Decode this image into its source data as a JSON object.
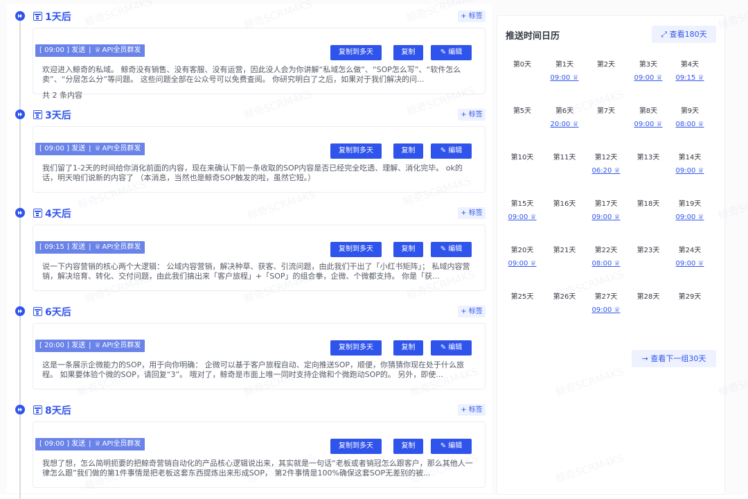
{
  "watermark": "鲸奇SCRM4KS",
  "days": [
    {
      "title": "1天后",
      "tag_button": "+ 标签",
      "send_label": "[ 09:00 ] 发送",
      "mode": "API全员群发",
      "buttons": {
        "multi": "复制到多天",
        "copy": "复制",
        "edit": "编辑"
      },
      "content": "欢迎进入鲸奇的私域。 鲸奇没有销售、没有客服、没有运营，因此没人会为你讲解“私域怎么做”、“SOP怎么写”、“软件怎么卖”、“分层怎么分”等问题。 这些问题全部在公众号可以免费查阅。 你研究明白了之后，如果对于我们解决的问...",
      "count": "共 2 条内容"
    },
    {
      "title": "3天后",
      "tag_button": "+ 标签",
      "send_label": "[ 09:00 ] 发送",
      "mode": "API全员群发",
      "buttons": {
        "multi": "复制到多天",
        "copy": "复制",
        "edit": "编辑"
      },
      "content": "我们留了1-2天的时间给你消化前面的内容，现在来确认下前一条收取的SOP内容是否已经完全吃透、理解、消化完毕。 ok的话，明天咱们说新的内容了 （本消息，当然也是鲸奇SOP触发的啦，虽然它短。）"
    },
    {
      "title": "4天后",
      "tag_button": "+ 标签",
      "send_label": "[ 09:15 ] 发送",
      "mode": "API全员群发",
      "buttons": {
        "multi": "复制到多天",
        "copy": "复制",
        "edit": "编辑"
      },
      "content": "说一下内容营销的核心两个大逻辑： 公域内容营销，解决种草、获客、引流问题，由此我们干出了「小红书矩阵」； 私域内容营销，解决培育、转化、交付问题，由此我们搞出来「客户旅程」+「SOP」的组合拳，企微、个微都支持。 你是「获..."
    },
    {
      "title": "6天后",
      "tag_button": "+ 标签",
      "send_label": "[ 20:00 ] 发送",
      "mode": "API全员群发",
      "buttons": {
        "multi": "复制到多天",
        "copy": "复制",
        "edit": "编辑"
      },
      "content": "这是一条展示企微能力的SOP，用于向你明确： 企微可以基于客户旅程自动、定向推送SOP，顺便，你猜猜你现在处于什么旅程。 如果要体验个微的SOP，请回复“3”。 哦对了，鲸奇是市面上唯一同时支持企微和个微跑动SOP的。 另外，即使..."
    },
    {
      "title": "8天后",
      "tag_button": "+ 标签",
      "send_label": "[ 09:00 ] 发送",
      "mode": "API全员群发",
      "buttons": {
        "multi": "复制到多天",
        "copy": "复制",
        "edit": "编辑"
      },
      "content": "我想了想，怎么简明扼要的把鲸奇营销自动化的产品核心逻辑说出来，其实就是一句话“老板或者销冠怎么跟客户，那么其他人一律怎么跟”我们做的第1件事情是把老板这套东西提炼出来形成SOP， 第2件事情是100%确保这套SOP无差别的被..."
    }
  ],
  "calendar": {
    "title": "推送时间日历",
    "view_180": "查看180天",
    "next_30": "查看下一组30天",
    "cells": [
      {
        "day": "第0天",
        "time": ""
      },
      {
        "day": "第1天",
        "time": "09:00"
      },
      {
        "day": "第2天",
        "time": ""
      },
      {
        "day": "第3天",
        "time": "09:00"
      },
      {
        "day": "第4天",
        "time": "09:15"
      },
      {
        "day": "第5天",
        "time": ""
      },
      {
        "day": "第6天",
        "time": "20:00"
      },
      {
        "day": "第7天",
        "time": ""
      },
      {
        "day": "第8天",
        "time": "09:00"
      },
      {
        "day": "第9天",
        "time": "08:00"
      },
      {
        "day": "第10天",
        "time": ""
      },
      {
        "day": "第11天",
        "time": ""
      },
      {
        "day": "第12天",
        "time": "06:20"
      },
      {
        "day": "第13天",
        "time": ""
      },
      {
        "day": "第14天",
        "time": "09:00"
      },
      {
        "day": "第15天",
        "time": "09:00"
      },
      {
        "day": "第16天",
        "time": ""
      },
      {
        "day": "第17天",
        "time": "09:00"
      },
      {
        "day": "第18天",
        "time": ""
      },
      {
        "day": "第19天",
        "time": "09:00"
      },
      {
        "day": "第20天",
        "time": "09:00"
      },
      {
        "day": "第21天",
        "time": ""
      },
      {
        "day": "第22天",
        "time": "08:00"
      },
      {
        "day": "第23天",
        "time": ""
      },
      {
        "day": "第24天",
        "time": "09:00"
      },
      {
        "day": "第25天",
        "time": ""
      },
      {
        "day": "第26天",
        "time": ""
      },
      {
        "day": "第27天",
        "time": "09:00"
      },
      {
        "day": "第28天",
        "time": ""
      },
      {
        "day": "第29天",
        "time": ""
      }
    ]
  }
}
